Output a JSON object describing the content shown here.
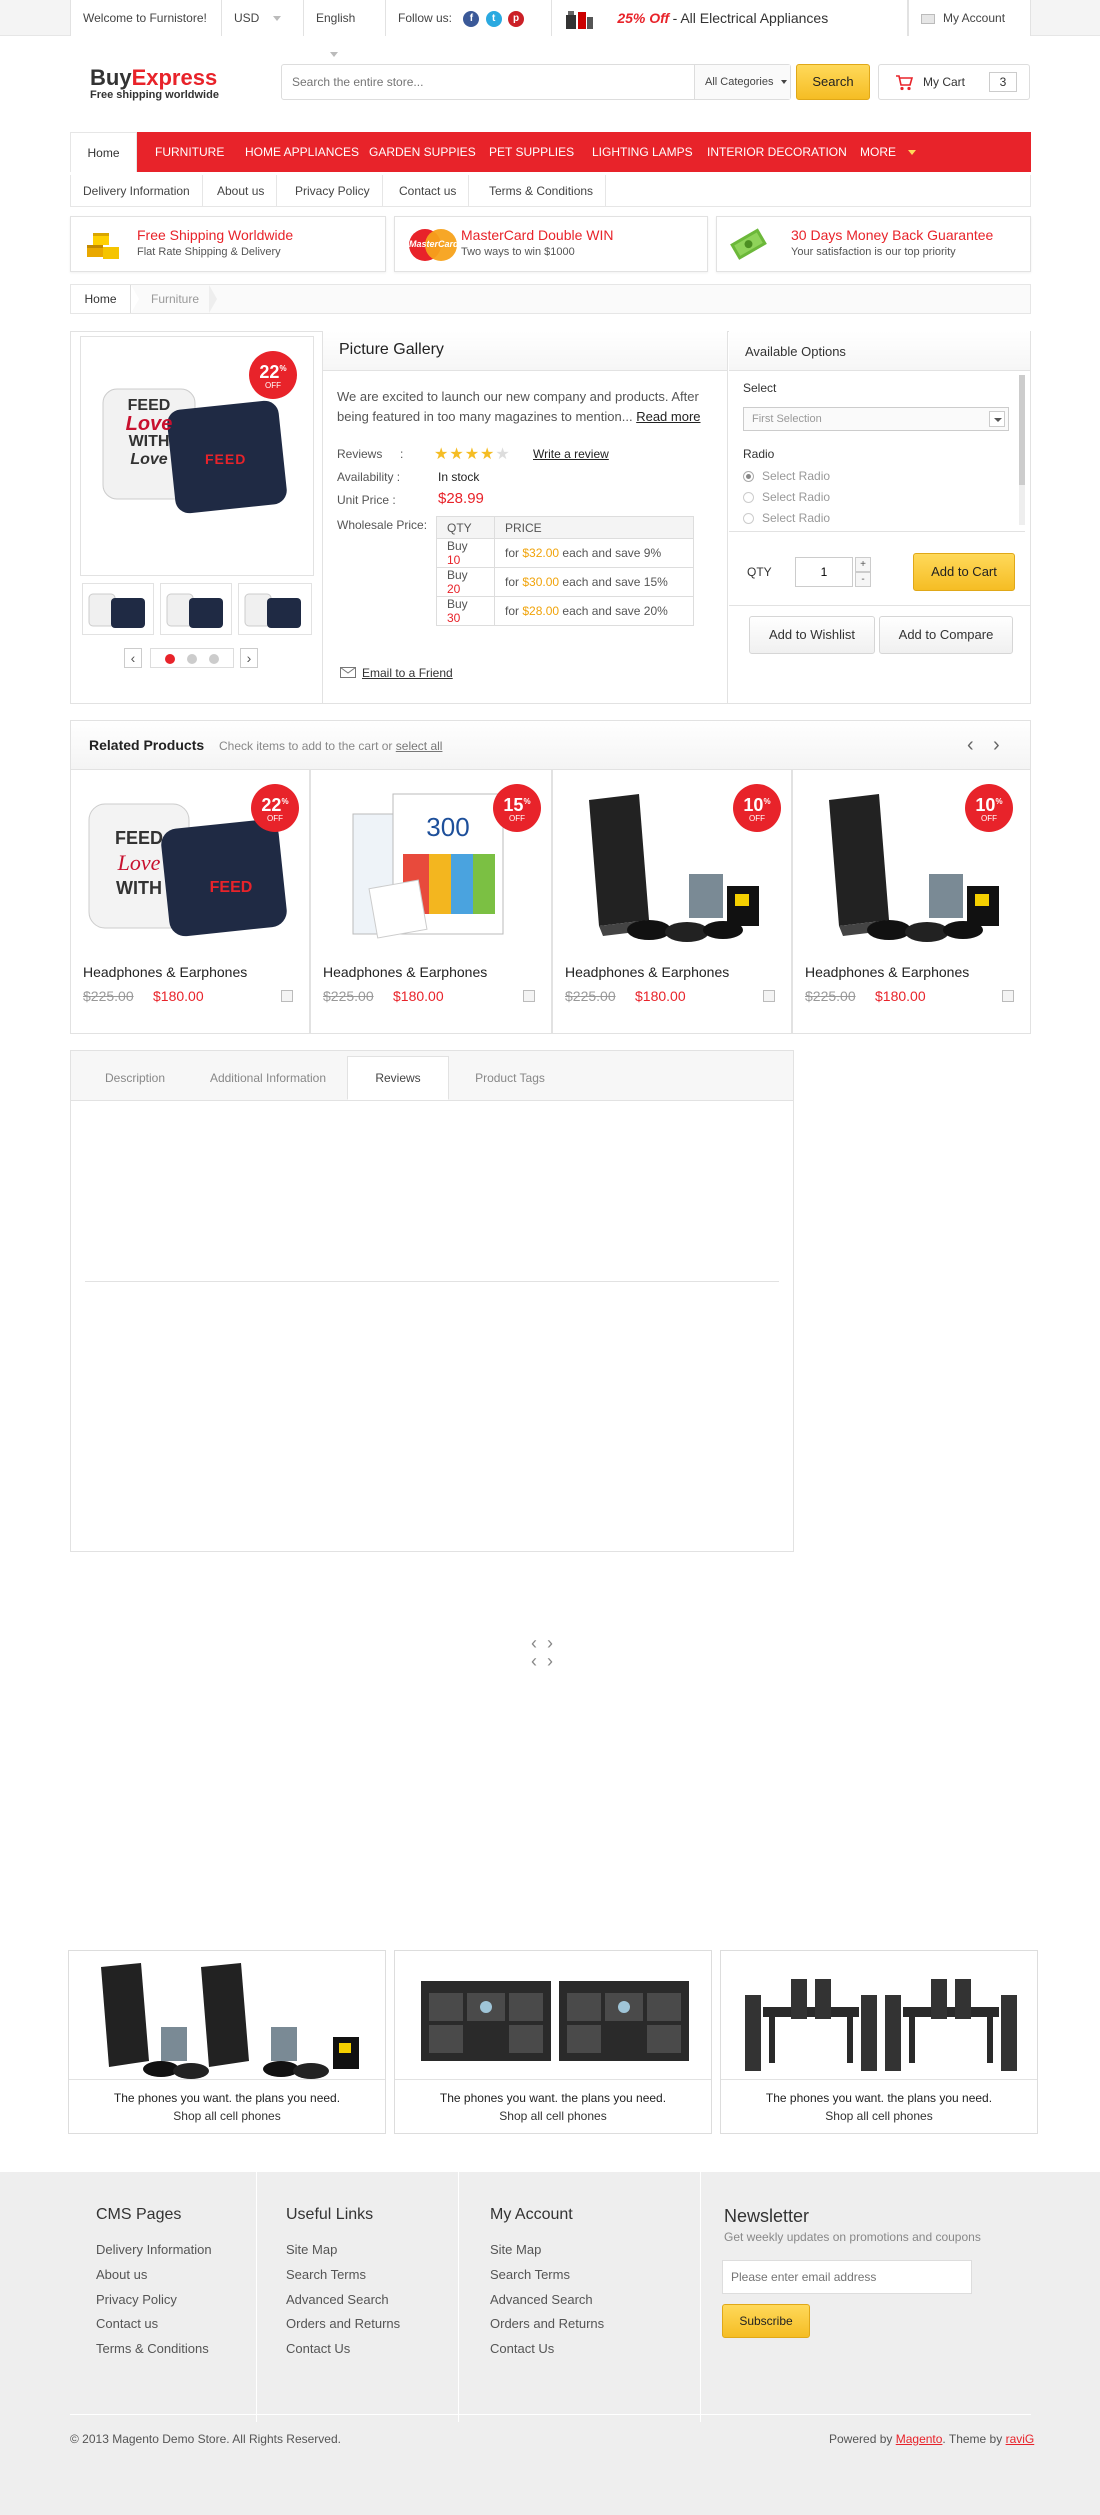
{
  "topbar": {
    "welcome": "Welcome to Furnistore!",
    "currency": "USD",
    "language": "English",
    "follow_label": "Follow us:",
    "promo_prefix": "25% Off",
    "promo_text": "- All Electrical Appliances",
    "account": "My Account"
  },
  "header": {
    "logo_part1": "Buy",
    "logo_part2": "Express",
    "tagline": "Free shipping worldwide",
    "search_placeholder": "Search the entire store...",
    "category_select": "All Categories",
    "search_button": "Search",
    "cart_label": "My Cart",
    "cart_count": "3"
  },
  "nav": {
    "home": "Home",
    "items": [
      "FURNITURE",
      "HOME APPLIANCES",
      "GARDEN SUPPIES",
      "PET SUPPLIES",
      "LIGHTING LAMPS",
      "INTERIOR DECORATION",
      "MORE"
    ]
  },
  "subnav": [
    "Delivery Information",
    "About us",
    "Privacy Policy",
    "Contact us",
    "Terms & Conditions"
  ],
  "promos": [
    {
      "title": "Free Shipping Worldwide",
      "sub": "Flat Rate Shipping & Delivery",
      "icon": "boxes-icon"
    },
    {
      "title": "MasterCard Double WIN",
      "sub": "Two ways to win $1000",
      "icon": "mastercard-icon",
      "logo_text": "MasterCard"
    },
    {
      "title": "30 Days Money Back Guarantee",
      "sub": "Your satisfaction is our top priority",
      "icon": "money-icon"
    }
  ],
  "breadcrumb": [
    "Home",
    "Furniture"
  ],
  "product": {
    "badge_pct": "22",
    "badge_sup": "%",
    "badge_off": "OFF",
    "title": "Picture Gallery",
    "description": "We are excited to launch our new company and products. After being featured in too many magazines to mention...",
    "read_more": "Read more",
    "reviews_label": "Reviews",
    "rating": 4,
    "rating_max": 5,
    "write_review": "Write a review",
    "availability_label": "Availability :",
    "availability": "In stock",
    "unit_price_label": "Unit Price :",
    "unit_price": "$28.99",
    "wholesale_label": "Wholesale Price:",
    "colon": ":",
    "wholesale_headers": [
      "QTY",
      "PRICE"
    ],
    "wholesale_rows": [
      {
        "buy": "Buy",
        "qty": "10",
        "for": "for",
        "price": "$32.00",
        "save": "each and save 9%"
      },
      {
        "buy": "Buy",
        "qty": "20",
        "for": "for",
        "price": "$30.00",
        "save": "each and save 15%"
      },
      {
        "buy": "Buy",
        "qty": "30",
        "for": "for",
        "price": "$28.00",
        "save": "each and save 20%"
      }
    ],
    "email_friend": "Email to a Friend",
    "pillow_text": [
      "FEED",
      "Love",
      "WITH",
      "Love"
    ],
    "pillow_text2": "FEED"
  },
  "options": {
    "title": "Available Options",
    "select_label": "Select",
    "select_value": "First Selection",
    "radio_label": "Radio",
    "radios": [
      "Select Radio",
      "Select Radio",
      "Select Radio"
    ],
    "qty_label": "QTY",
    "qty_value": "1",
    "add_to_cart": "Add to Cart",
    "wishlist": "Add to Wishlist",
    "compare": "Add to Compare"
  },
  "related": {
    "title": "Related Products",
    "hint": "Check items to add to the cart or",
    "select_all": "select all",
    "items": [
      {
        "name": "Headphones & Earphones",
        "old": "$225.00",
        "new": "$180.00",
        "badge": "22"
      },
      {
        "name": "Headphones & Earphones",
        "old": "$225.00",
        "new": "$180.00",
        "badge": "15"
      },
      {
        "name": "Headphones & Earphones",
        "old": "$225.00",
        "new": "$180.00",
        "badge": "10"
      },
      {
        "name": "Headphones & Earphones",
        "old": "$225.00",
        "new": "$180.00",
        "badge": "10"
      }
    ]
  },
  "tabs": [
    "Description",
    "Additional Information",
    "Reviews",
    "Product Tags"
  ],
  "banners": [
    {
      "title": "The phones you want. the plans you need.",
      "sub": "Shop all cell phones"
    },
    {
      "title": "The phones you want. the plans you need.",
      "sub": "Shop all cell phones"
    },
    {
      "title": "The phones you want. the plans you need.",
      "sub": "Shop all cell phones"
    }
  ],
  "footer": {
    "cols": [
      {
        "title": "CMS Pages",
        "links": [
          "Delivery Information",
          "About us",
          "Privacy Policy",
          "Contact us",
          "Terms & Conditions"
        ]
      },
      {
        "title": "Useful Links",
        "links": [
          "Site Map",
          "Search Terms",
          "Advanced Search",
          "Orders and Returns",
          "Contact Us"
        ]
      },
      {
        "title": "My Account",
        "links": [
          "Site Map",
          "Search Terms",
          "Advanced Search",
          "Orders and Returns",
          "Contact Us"
        ]
      }
    ],
    "newsletter_title": "Newsletter",
    "newsletter_sub": "Get weekly updates on promotions and coupons",
    "email_placeholder": "Please enter email address",
    "subscribe": "Subscribe",
    "copyright": "© 2013 Magento Demo Store. All Rights Reserved.",
    "powered_prefix": "Powered by",
    "powered_link": "Magento",
    "theme_prefix": ". Theme by",
    "theme_link": "raviG"
  },
  "colors": {
    "accent_red": "#e8232a",
    "button_yellow": "#f5bd24",
    "price_orange": "#f0a30a"
  }
}
